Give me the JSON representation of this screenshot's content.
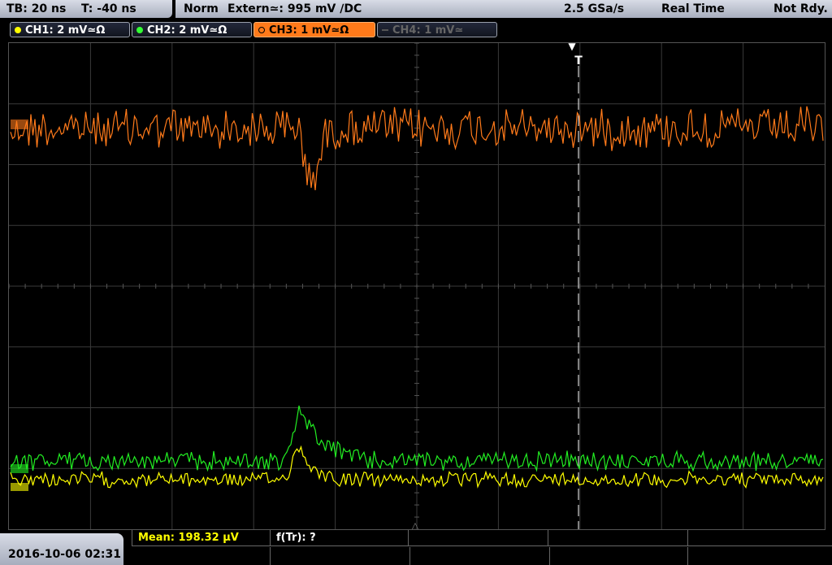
{
  "header": {
    "timebase": "TB: 20 ns",
    "trigger_time": "T: -40 ns",
    "mode": "Norm",
    "trigger_source": "Extern≃: 995 mV ∕DC",
    "sample_rate": "2.5 GSa/s",
    "acquisition": "Real Time",
    "status": "Not Rdy."
  },
  "channels": [
    {
      "label": "CH1: 2 mV≃Ω",
      "color": "#ffff00",
      "state": "on"
    },
    {
      "label": "CH2: 2 mV≃Ω",
      "color": "#33ff33",
      "state": "on"
    },
    {
      "label": "CH3: 1 mV≃Ω",
      "color": "#ff7a1a",
      "state": "selected"
    },
    {
      "label": "CH4: 1 mV≃",
      "color": "#555555",
      "state": "off"
    }
  ],
  "trigger_marker": "T",
  "footer": {
    "datetime": "2016-10-06 02:31",
    "measurement": "Mean: 198.32 µV",
    "function": "f(Tr): ?"
  },
  "colors": {
    "ch1": "#ffff00",
    "ch2": "#22ee22",
    "ch3": "#ff7a1a",
    "grid": "#3a3a3a"
  }
}
